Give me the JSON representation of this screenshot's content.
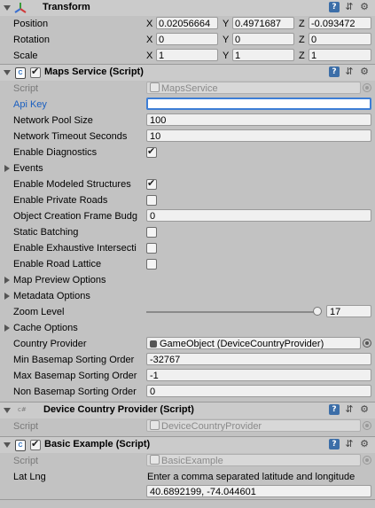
{
  "transform": {
    "title": "Transform",
    "position": {
      "label": "Position",
      "x": "0.02056664",
      "y": "0.4971687",
      "z": "-0.093472"
    },
    "rotation": {
      "label": "Rotation",
      "x": "0",
      "y": "0",
      "z": "0"
    },
    "scale": {
      "label": "Scale",
      "x": "1",
      "y": "1",
      "z": "1"
    },
    "axis_x": "X",
    "axis_y": "Y",
    "axis_z": "Z"
  },
  "maps_service": {
    "title": "Maps Service (Script)",
    "enabled": true,
    "script_label": "Script",
    "script_value": "MapsService",
    "api_key_label": "Api Key",
    "api_key_value": "",
    "network_pool_size_label": "Network Pool Size",
    "network_pool_size": "100",
    "network_timeout_label": "Network Timeout Seconds",
    "network_timeout": "10",
    "enable_diagnostics_label": "Enable Diagnostics",
    "enable_diagnostics": true,
    "events_label": "Events",
    "enable_modeled_structures_label": "Enable Modeled Structures",
    "enable_modeled_structures": true,
    "enable_private_roads_label": "Enable Private Roads",
    "enable_private_roads": false,
    "object_creation_budget_label": "Object Creation Frame Budg",
    "object_creation_budget": "0",
    "static_batching_label": "Static Batching",
    "static_batching": false,
    "enable_exhaustive_label": "Enable Exhaustive Intersecti",
    "enable_exhaustive": false,
    "enable_road_lattice_label": "Enable Road Lattice",
    "enable_road_lattice": false,
    "map_preview_options_label": "Map Preview Options",
    "metadata_options_label": "Metadata Options",
    "zoom_level_label": "Zoom Level",
    "zoom_level": "17",
    "cache_options_label": "Cache Options",
    "country_provider_label": "Country Provider",
    "country_provider_value": "GameObject (DeviceCountryProvider)",
    "min_basemap_label": "Min Basemap Sorting Order",
    "min_basemap": "-32767",
    "max_basemap_label": "Max Basemap Sorting Order",
    "max_basemap": "-1",
    "non_basemap_label": "Non Basemap Sorting Order",
    "non_basemap": "0"
  },
  "device_country_provider": {
    "title": "Device Country Provider (Script)",
    "badge": "c#",
    "script_label": "Script",
    "script_value": "DeviceCountryProvider"
  },
  "basic_example": {
    "title": "Basic Example (Script)",
    "enabled": true,
    "script_label": "Script",
    "script_value": "BasicExample",
    "lat_lng_label": "Lat Lng",
    "lat_lng_hint": "Enter a comma separated latitude and longitude",
    "lat_lng_value": "40.6892199, -74.044601"
  }
}
